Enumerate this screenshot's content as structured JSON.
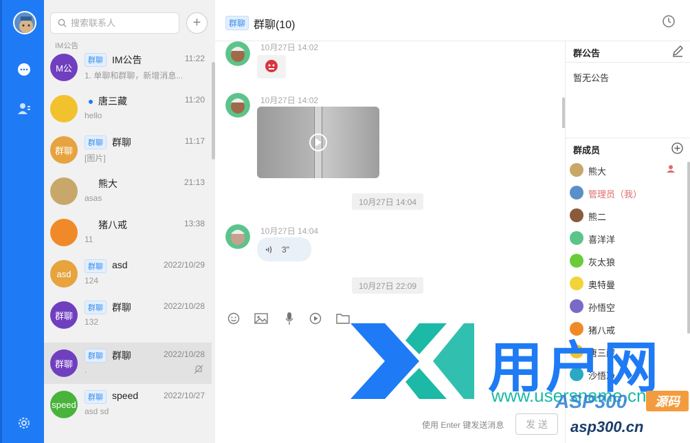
{
  "nav": {
    "icons": [
      "chat-icon",
      "contacts-icon",
      "settings-icon"
    ]
  },
  "search": {
    "placeholder": "搜索联系人",
    "add": "+"
  },
  "list_cut_label": "IM公告",
  "conversations": [
    {
      "avatar_text": "M公",
      "avatar_color": "#6f3fc0",
      "tag": "群聊",
      "name": "IM公告",
      "time": "11:22",
      "preview": "1. 单聊和群聊，新增消息..."
    },
    {
      "avatar_text": "",
      "avatar_color": "#f2c12e",
      "tag": "",
      "name": "唐三藏",
      "time": "11:20",
      "preview": "hello",
      "unread_dot": true
    },
    {
      "avatar_text": "群聊",
      "avatar_color": "#e6a33e",
      "tag": "群聊",
      "name": "群聊",
      "time": "11:17",
      "preview": "[图片]"
    },
    {
      "avatar_text": "",
      "avatar_color": "#c8a86a",
      "tag": "",
      "name": "熊大",
      "time": "21:13",
      "preview": "asas"
    },
    {
      "avatar_text": "",
      "avatar_color": "#f08a28",
      "tag": "",
      "name": "猪八戒",
      "time": "13:38",
      "preview": "11"
    },
    {
      "avatar_text": "asd",
      "avatar_color": "#e6a33e",
      "tag": "群聊",
      "name": "asd",
      "time": "2022/10/29",
      "preview": "124"
    },
    {
      "avatar_text": "群聊",
      "avatar_color": "#6f3fc0",
      "tag": "群聊",
      "name": "群聊",
      "time": "2022/10/28",
      "preview": "132"
    },
    {
      "avatar_text": "群聊",
      "avatar_color": "#6f3fc0",
      "tag": "群聊",
      "name": "群聊",
      "time": "2022/10/28",
      "preview": ".",
      "muted": true,
      "active": true
    },
    {
      "avatar_text": "speed",
      "avatar_color": "#49b33c",
      "tag": "群聊",
      "name": "speed",
      "time": "2022/10/27",
      "preview": "asd sd"
    }
  ],
  "chat": {
    "tag": "群聊",
    "title": "群聊(10)",
    "messages": [
      {
        "time": "10月27日 14:02",
        "type": "emoji"
      },
      {
        "time": "10月27日 14:02",
        "type": "video"
      },
      {
        "center_time": "10月27日 14:04"
      },
      {
        "time": "10月27日 14:04",
        "type": "voice",
        "duration": "3\""
      },
      {
        "center_time": "10月27日 22:09"
      }
    ],
    "send_hint": "使用 Enter 键发送消息",
    "send_label": "发 送"
  },
  "right_panel": {
    "notice_title": "群公告",
    "notice_text": "暂无公告",
    "members_title": "群成员",
    "members": [
      {
        "name": "熊大",
        "color": "#c8a86a",
        "owner": true
      },
      {
        "name": "管理员（我）",
        "color": "#5a8fc9",
        "me": true
      },
      {
        "name": "熊二",
        "color": "#8a5a3a"
      },
      {
        "name": "喜洋洋",
        "color": "#5cc48a"
      },
      {
        "name": "灰太狼",
        "color": "#6acb3a"
      },
      {
        "name": "奥特曼",
        "color": "#f2d33a"
      },
      {
        "name": "孙悟空",
        "color": "#7a6ac8"
      },
      {
        "name": "猪八戒",
        "color": "#f08a28"
      },
      {
        "name": "唐三藏",
        "color": "#f2c12e"
      },
      {
        "name": "沙悟净",
        "color": "#2ba8c4"
      }
    ]
  },
  "watermark": {
    "cn": "用户网",
    "url": "www.usersname.cn",
    "asp": "ASP300",
    "asp_tag": "源码",
    "asp_url": "asp300.cn"
  },
  "colors": {
    "primary": "#1e7bf5",
    "tag_text": "#3a8ee6",
    "me": "#e06b6b"
  }
}
